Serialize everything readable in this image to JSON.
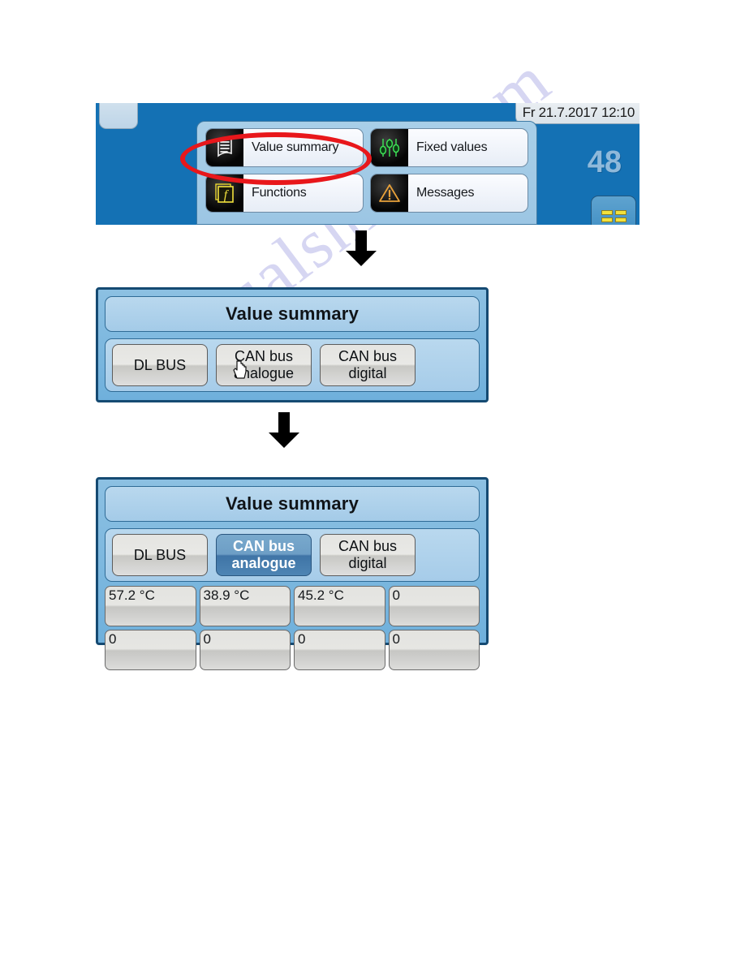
{
  "watermark": {
    "text": "manualshive.com"
  },
  "panel1": {
    "datetime": "Fr 21.7.2017 12:10",
    "counter": "48",
    "menu_items": [
      {
        "label": "Value summary",
        "icon": "document-list-icon"
      },
      {
        "label": "Fixed values",
        "icon": "sliders-icon"
      },
      {
        "label": "Functions",
        "icon": "function-f-icon"
      },
      {
        "label": "Messages",
        "icon": "warning-triangle-icon"
      }
    ]
  },
  "panel2": {
    "title": "Value summary",
    "tabs": [
      {
        "label_line1": "DL BUS",
        "label_line2": "",
        "selected": false
      },
      {
        "label_line1": "CAN bus",
        "label_line2": "analogue",
        "selected": false
      },
      {
        "label_line1": "CAN bus",
        "label_line2": "digital",
        "selected": false
      }
    ]
  },
  "panel3": {
    "title": "Value summary",
    "tabs": [
      {
        "label_line1": "DL BUS",
        "label_line2": "",
        "selected": false
      },
      {
        "label_line1": "CAN bus",
        "label_line2": "analogue",
        "selected": true
      },
      {
        "label_line1": "CAN bus",
        "label_line2": "digital",
        "selected": false
      }
    ],
    "values": [
      [
        "57.2 °C",
        "38.9 °C",
        "45.2 °C",
        "0"
      ],
      [
        "0",
        "0",
        "0",
        "0"
      ]
    ]
  },
  "colors": {
    "screen_blue": "#1471b4",
    "panel_blue": "#8cc0e2",
    "annotation_red": "#e8171b",
    "selected_tab": "#4e85b4",
    "icon_green": "#3ddc55",
    "icon_yellow": "#f2e13c",
    "icon_orange": "#e8a13a"
  }
}
